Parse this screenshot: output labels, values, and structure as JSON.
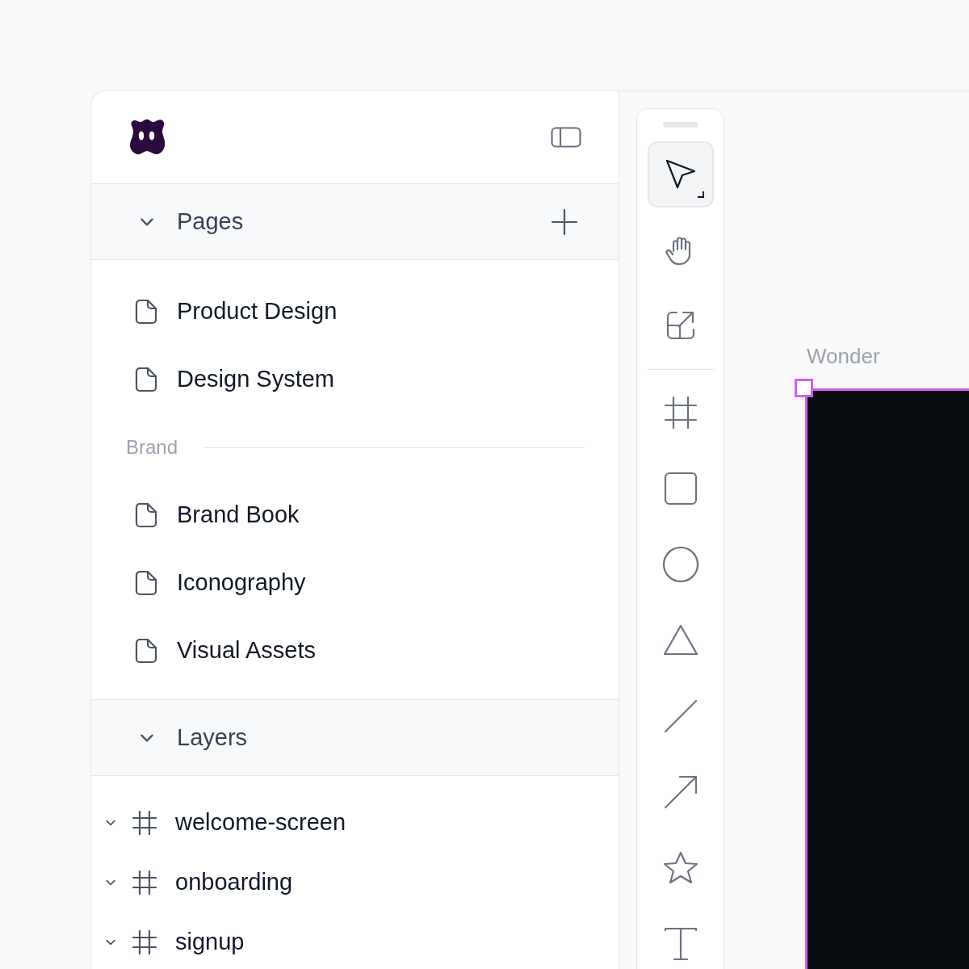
{
  "sidebar": {
    "pages_section": {
      "title": "Pages",
      "expanded": true
    },
    "pages": [
      {
        "kind": "page",
        "label": "Product Design"
      },
      {
        "kind": "page",
        "label": "Design System"
      },
      {
        "kind": "group",
        "label": "Brand"
      },
      {
        "kind": "page",
        "label": "Brand Book"
      },
      {
        "kind": "page",
        "label": "Iconography"
      },
      {
        "kind": "page",
        "label": "Visual Assets"
      }
    ],
    "layers_section": {
      "title": "Layers",
      "expanded": true
    },
    "layers": [
      {
        "label": "welcome-screen",
        "expanded": true
      },
      {
        "label": "onboarding",
        "expanded": true
      },
      {
        "label": "signup",
        "expanded": true
      }
    ]
  },
  "toolbar": {
    "tools": [
      {
        "kind": "pointer",
        "selected": true
      },
      {
        "kind": "hand",
        "selected": false
      },
      {
        "kind": "export",
        "selected": false
      },
      {
        "kind": "separator"
      },
      {
        "kind": "frame",
        "selected": false
      },
      {
        "kind": "rectangle",
        "selected": false
      },
      {
        "kind": "ellipse",
        "selected": false
      },
      {
        "kind": "triangle",
        "selected": false
      },
      {
        "kind": "line",
        "selected": false
      },
      {
        "kind": "arrow",
        "selected": false
      },
      {
        "kind": "star",
        "selected": false
      },
      {
        "kind": "text",
        "selected": false
      }
    ]
  },
  "canvas": {
    "frame_label": "Wonder"
  }
}
